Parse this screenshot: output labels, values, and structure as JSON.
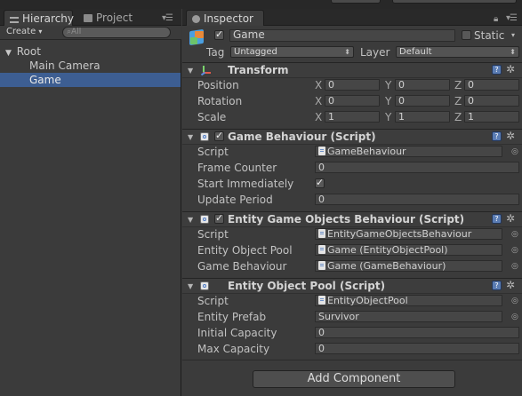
{
  "hierarchy": {
    "tab_label": "Hierarchy",
    "create_label": "Create",
    "search_placeholder": "All",
    "items": [
      {
        "label": "Root"
      },
      {
        "label": "Main Camera"
      },
      {
        "label": "Game"
      }
    ]
  },
  "project": {
    "tab_label": "Project"
  },
  "inspector": {
    "tab_label": "Inspector",
    "object_name": "Game",
    "static_label": "Static",
    "tag_label": "Tag",
    "tag_value": "Untagged",
    "layer_label": "Layer",
    "layer_value": "Default",
    "transform": {
      "title": "Transform",
      "rows": [
        {
          "label": "Position",
          "x": "0",
          "y": "0",
          "z": "0"
        },
        {
          "label": "Rotation",
          "x": "0",
          "y": "0",
          "z": "0"
        },
        {
          "label": "Scale",
          "x": "1",
          "y": "1",
          "z": "1"
        }
      ]
    },
    "game_behaviour": {
      "title": "Game Behaviour (Script)",
      "script_label": "Script",
      "script_value": "GameBehaviour",
      "frame_counter_label": "Frame Counter",
      "frame_counter_value": "0",
      "start_immediately_label": "Start Immediately",
      "update_period_label": "Update Period",
      "update_period_value": "0"
    },
    "entity_game_objects": {
      "title": "Entity Game Objects Behaviour (Script)",
      "script_label": "Script",
      "script_value": "EntityGameObjectsBehaviour",
      "pool_label": "Entity Object Pool",
      "pool_value": "Game (EntityObjectPool)",
      "gb_label": "Game Behaviour",
      "gb_value": "Game (GameBehaviour)"
    },
    "entity_object_pool": {
      "title": "Entity Object Pool (Script)",
      "script_label": "Script",
      "script_value": "EntityObjectPool",
      "prefab_label": "Entity Prefab",
      "prefab_value": "Survivor",
      "initial_label": "Initial Capacity",
      "initial_value": "0",
      "max_label": "Max Capacity",
      "max_value": "0"
    },
    "add_component_label": "Add Component"
  },
  "axes": {
    "x": "X",
    "y": "Y",
    "z": "Z"
  },
  "colors": {
    "selection": "#3d5e92",
    "panel": "#3b3b3b",
    "help_icon": "#5a7cb3"
  }
}
